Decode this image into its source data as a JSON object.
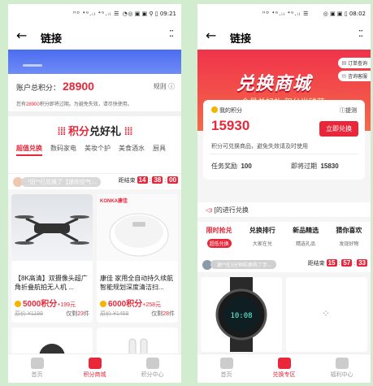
{
  "left": {
    "status": {
      "icons": "ᴴᴰ ⁴ᴳ.ᵢₗ ⁴ᴳ.ᵢₗ ☰ ◔",
      "right": "◎ ▣ ▣ ⚲ ▯ 09:21"
    },
    "nav": {
      "title": "链接"
    },
    "account": {
      "label": "账户总积分：",
      "points": "28900",
      "rule": "规则",
      "notice_prefix": "您有",
      "notice_points": "28900",
      "notice_suffix": "积分即将过期。为避免失效，请尽快使用。"
    },
    "mall_title": "积分",
    "mall_title2": "兑好礼",
    "categories": [
      "超值兑换",
      "数码家电",
      "美妆个护",
      "美食酒水",
      "厨具"
    ],
    "ticker": "*旧**已兑换了【迷你空气...",
    "countdown": {
      "label": "距结束",
      "h": "14",
      "m": "38",
      "s": "00"
    },
    "products": [
      {
        "name": "【8K高清】双摄像头超广角折叠航拍无人机 ...",
        "points": "5000积分",
        "extra": "+199元",
        "orig": "原价 ¥1199",
        "sold_prefix": "仅剩",
        "sold_num": "23",
        "sold_suffix": "件"
      },
      {
        "brand": "KONKA康佳",
        "name": "康佳 家用全自动持久续航智能规划深度清洁扫...",
        "points": "6000积分",
        "extra": "+258元",
        "orig": "原价 ¥1458",
        "sold_prefix": "仅剩",
        "sold_num": "28",
        "sold_suffix": "件"
      }
    ],
    "tabs": [
      "首页",
      "积分商城",
      "积分中心"
    ]
  },
  "right": {
    "status": {
      "icons": "ᴴᴰ ⁴ᴳ.ᵢₗ ⁴ᴳ.ᵢₗ ☰",
      "right": "◎ ▣ ▣ ▯ 08:02"
    },
    "nav": {
      "title": "链接"
    },
    "banner": {
      "title": "兑换商城",
      "subtitle": "会员兑好礼 积分当钱花",
      "btn1": "订单查询",
      "btn2": "咨询客服"
    },
    "card": {
      "label": "我的积分",
      "rule": "提测",
      "points": "15930",
      "btn": "立即兑换",
      "desc": "积分可兑换商品，避免失效请及时使用",
      "task_label": "任务奖励",
      "task_value": "100",
      "expire_label": "即将过期",
      "expire_value": "15830"
    },
    "marquee": "[的进行兑换",
    "cats": [
      {
        "title": "限时抢兑",
        "sub": "超低兑换"
      },
      {
        "title": "兑换排行",
        "sub": "大家在兑"
      },
      {
        "title": "新品精选",
        "sub": "精选礼品"
      },
      {
        "title": "猜你喜欢",
        "sub": "发现好物"
      }
    ],
    "ticker": "谢**在3分钟前换购了手...",
    "countdown": {
      "label": "距结束",
      "h": "15",
      "m": "57",
      "s": "33"
    },
    "tabs": [
      "首页",
      "兑换专区",
      "福利中心"
    ]
  }
}
